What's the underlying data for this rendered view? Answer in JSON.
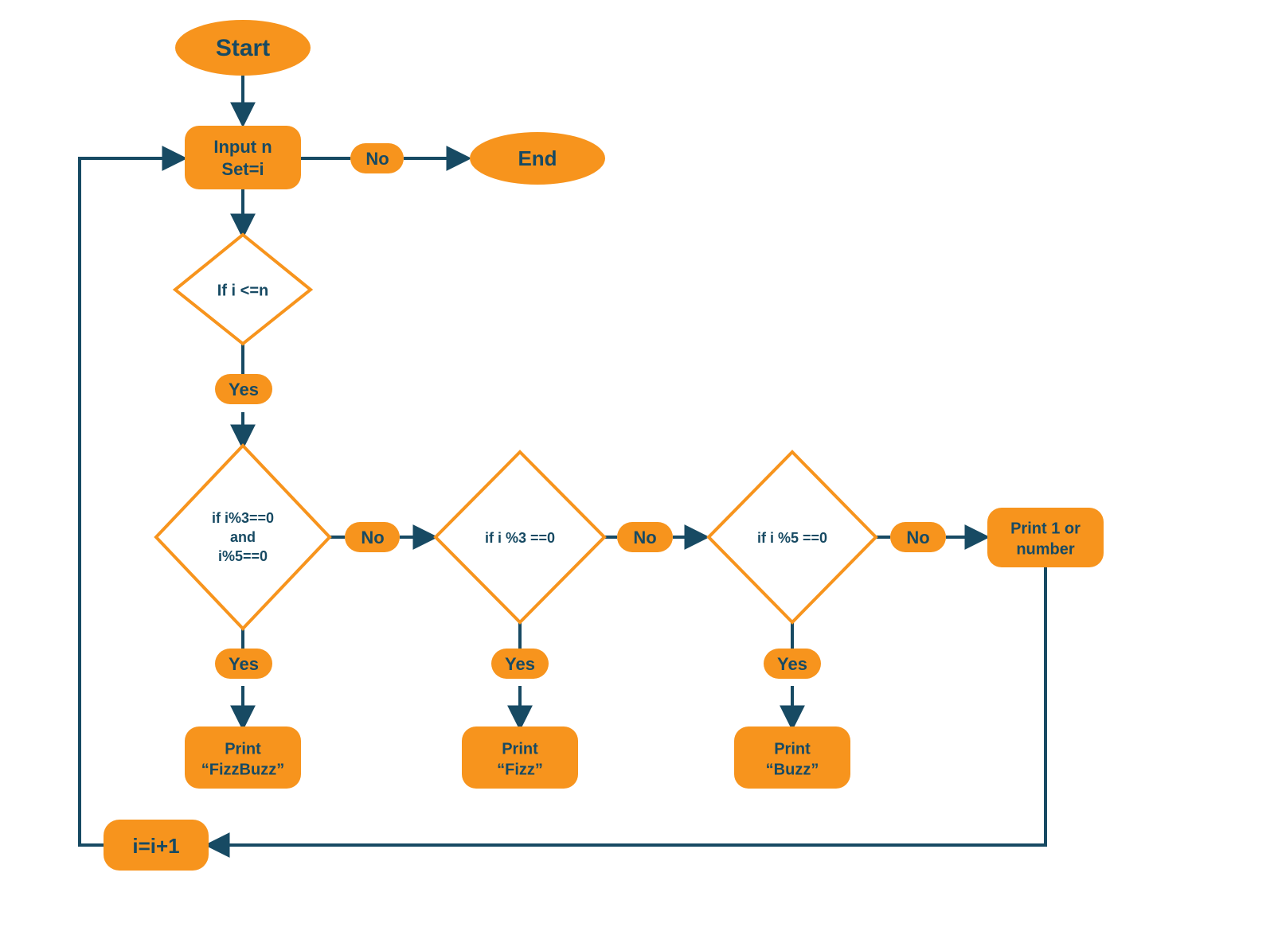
{
  "colors": {
    "accent": "#f7941d",
    "line": "#174a63",
    "text": "#174a63",
    "diamond_bg": "#ffffff"
  },
  "nodes": {
    "start": "Start",
    "input_l1": "Input n",
    "input_l2": "Set=i",
    "end": "End",
    "cond_loop": "If i <=n",
    "cond_fb_l1": "if i%3==0",
    "cond_fb_l2": "and",
    "cond_fb_l3": "i%5==0",
    "cond_3": "if i %3 ==0",
    "cond_5": "if i %5 ==0",
    "print_fb_l1": "Print",
    "print_fb_l2": "“FizzBuzz”",
    "print_fizz_l1": "Print",
    "print_fizz_l2": "“Fizz”",
    "print_buzz_l1": "Print",
    "print_buzz_l2": "“Buzz”",
    "print_num_l1": "Print 1 or",
    "print_num_l2": "number",
    "incr": "i=i+1"
  },
  "labels": {
    "yes": "Yes",
    "no": "No"
  }
}
